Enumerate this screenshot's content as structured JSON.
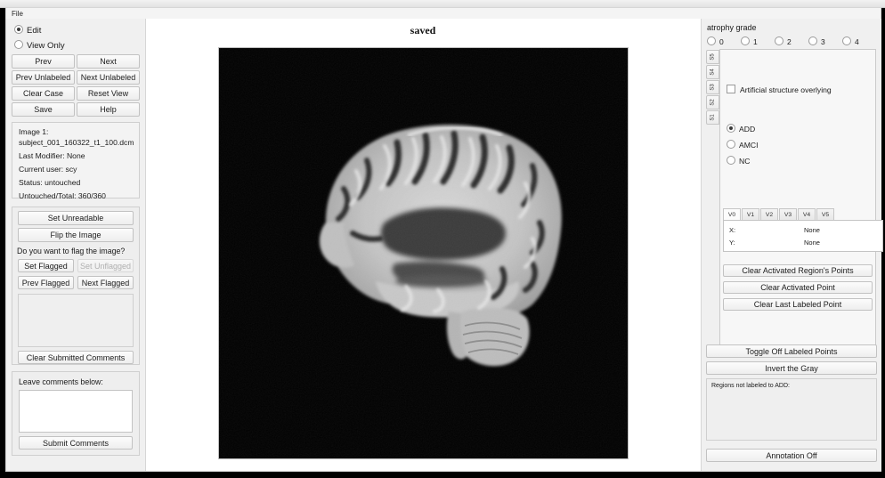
{
  "window": {
    "menu": [
      "File"
    ],
    "header_status": "saved"
  },
  "left_panel": {
    "mode_options": [
      {
        "label": "Edit",
        "selected": true
      },
      {
        "label": "View Only",
        "selected": false
      }
    ],
    "nav_buttons": [
      {
        "label": "Prev",
        "enabled": true
      },
      {
        "label": "Next",
        "enabled": true
      },
      {
        "label": "Prev Unlabeled",
        "enabled": true
      },
      {
        "label": "Next Unlabeled",
        "enabled": true
      },
      {
        "label": "Clear Case",
        "enabled": true
      },
      {
        "label": "Reset View",
        "enabled": true
      },
      {
        "label": "Save",
        "enabled": true
      },
      {
        "label": "Help",
        "enabled": true
      }
    ],
    "info": {
      "image_label": "Image 1:",
      "filename": "subject_001_160322_t1_100.dcm",
      "last_modifier": "Last Modifier: None",
      "current_user": "Current user: scy",
      "status": "Status: untouched",
      "untouched_total": "Untouched/Total: 360/360"
    },
    "set_unreadable": "Set Unreadable",
    "flip_image": "Flip the Image",
    "flag_prompt": "Do you want to flag the image?",
    "flag_buttons": [
      {
        "label": "Set Flagged",
        "enabled": true
      },
      {
        "label": "Set Unflagged",
        "enabled": false
      },
      {
        "label": "Prev Flagged",
        "enabled": true
      },
      {
        "label": "Next Flagged",
        "enabled": true
      }
    ],
    "submitted_comments_value": "",
    "clear_submitted_comments": "Clear Submitted Comments",
    "comments_label": "Leave comments below:",
    "comments_value": "",
    "submit_comments": "Submit Comments"
  },
  "right_panel": {
    "atrophy_grade_label": "atrophy grade",
    "atrophy_options": [
      {
        "label": "0",
        "selected": false
      },
      {
        "label": "1",
        "selected": false
      },
      {
        "label": "2",
        "selected": false
      },
      {
        "label": "3",
        "selected": false
      },
      {
        "label": "4",
        "selected": false
      }
    ],
    "vertical_tabs": [
      "S5",
      "S4",
      "S3",
      "S2",
      "S1"
    ],
    "artificial_structure": {
      "label": "Artificial structure overlying",
      "checked": false
    },
    "diagnosis_options": [
      {
        "label": "ADD",
        "selected": true
      },
      {
        "label": "AMCI",
        "selected": false
      },
      {
        "label": "NC",
        "selected": false
      }
    ],
    "view_tabs": [
      {
        "label": "V0",
        "active": true
      },
      {
        "label": "V1",
        "active": false
      },
      {
        "label": "V2",
        "active": false
      },
      {
        "label": "V3",
        "active": false
      },
      {
        "label": "V4",
        "active": false
      },
      {
        "label": "V5",
        "active": false
      }
    ],
    "coords": {
      "x_label": "X:",
      "x_value": "None",
      "y_label": "Y:",
      "y_value": "None"
    },
    "clear_buttons": [
      "Clear Activated Region's Points",
      "Clear Activated Point",
      "Clear Last Labeled Point"
    ],
    "toggle_labeled_points": "Toggle Off Labeled Points",
    "invert_gray": "Invert the Gray",
    "regions_not_labeled_label": "Regions not labeled to ADD:",
    "regions_not_labeled_value": "",
    "annotation_toggle": "Annotation Off"
  },
  "viewer": {
    "modality": "MRI T1 sagittal slice",
    "background_color": "#000000"
  }
}
